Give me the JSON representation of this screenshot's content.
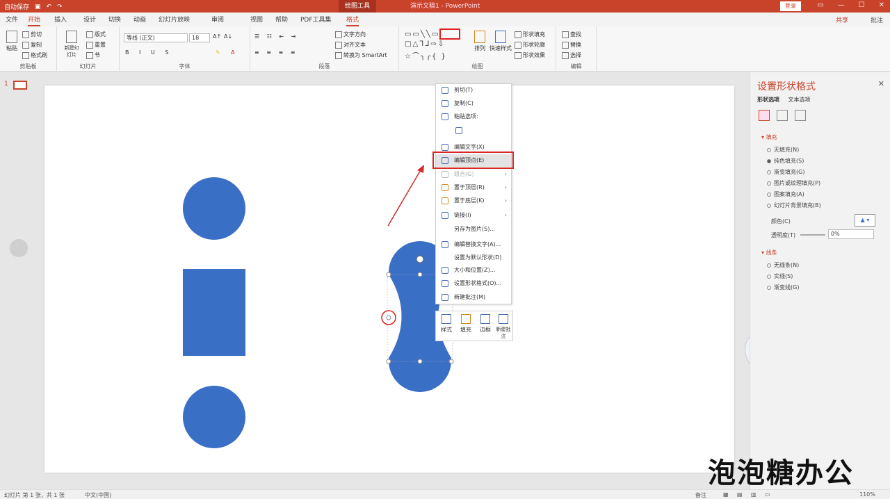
{
  "titlebar": {
    "qa_text": "自动保存",
    "context_tool": "绘图工具",
    "doc_title": "演示文稿1 - PowerPoint",
    "login": "登录"
  },
  "tabs": [
    "文件",
    "开始",
    "插入",
    "设计",
    "切换",
    "动画",
    "幻灯片放映",
    "审阅",
    "视图",
    "帮助",
    "PDF工具集",
    "格式"
  ],
  "tabs_share": "共享",
  "tabs_comment": "批注",
  "ribbon": {
    "clipboard": {
      "paste": "粘贴",
      "cut": "剪切",
      "copy": "复制",
      "painter": "格式刷",
      "label": "剪贴板"
    },
    "slides": {
      "new": "新建幻灯片",
      "layout": "版式",
      "reset": "重置",
      "section": "节",
      "label": "幻灯片"
    },
    "font": {
      "name": "等线 (正文)",
      "size": "18",
      "label": "字体"
    },
    "paragraph": {
      "direction": "文字方向",
      "align": "对齐文本",
      "smartart": "转换为 SmartArt",
      "label": "段落"
    },
    "drawing": {
      "arrange": "排列",
      "quick_styles": "快速样式",
      "fill": "形状填充",
      "outline": "形状轮廓",
      "effects": "形状效果",
      "label": "绘图"
    },
    "editing": {
      "find": "查找",
      "replace": "替换",
      "select": "选择",
      "label": "编辑"
    }
  },
  "slide_number": "1",
  "context_menu": {
    "items": [
      "剪切(T)",
      "复制(C)",
      "粘贴选项:",
      "",
      "编辑文字(X)",
      "编辑顶点(E)",
      "组合(G)",
      "置于顶层(R)",
      "置于底层(K)",
      "链接(I)",
      "另存为图片(S)...",
      "编辑替换文字(A)...",
      "设置为默认形状(D)",
      "大小和位置(Z)...",
      "设置形状格式(O)...",
      "新建批注(M)"
    ]
  },
  "mini_toolbar": [
    "样式",
    "填充",
    "边框",
    "新建批注"
  ],
  "right_pane": {
    "title": "设置形状格式",
    "tabs": [
      "形状选项",
      "文本选项"
    ],
    "fill_section": "填充",
    "fill_options": [
      "无填充(N)",
      "纯色填充(S)",
      "渐变填充(G)",
      "图片或纹理填充(P)",
      "图案填充(A)",
      "幻灯片背景填充(B)"
    ],
    "color_label": "颜色(C)",
    "transparency_label": "透明度(T)",
    "transparency_value": "0%",
    "line_section": "线条",
    "line_options": [
      "无线条(N)",
      "实线(S)",
      "渐变线(G)"
    ]
  },
  "status": {
    "slide_info": "幻灯片 第 1 张，共 1 张",
    "lang": "中文(中国)",
    "notes": "备注",
    "zoom": "110%"
  },
  "watermark": "泡泡糖办公",
  "colors": {
    "accent": "#c8432a",
    "shape": "#3a6fc6",
    "highlight": "#e02020"
  }
}
